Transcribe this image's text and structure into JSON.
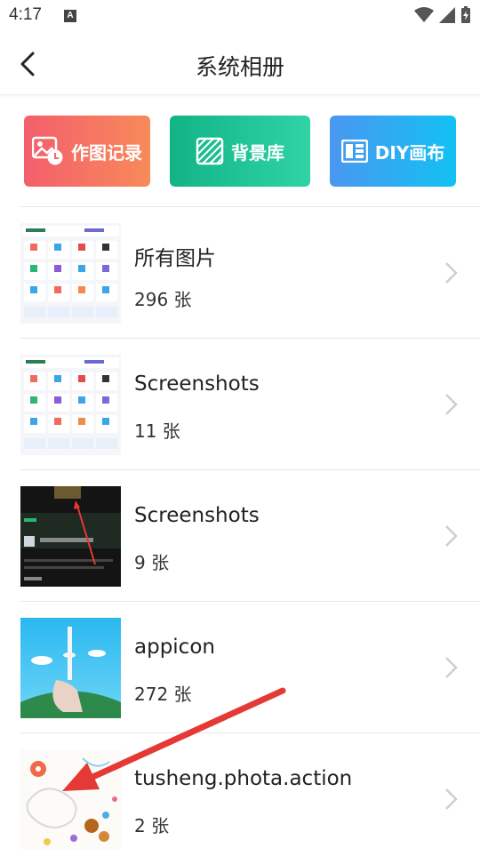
{
  "status_bar": {
    "time": "4:17"
  },
  "header": {
    "title": "系统相册"
  },
  "shortcuts": [
    {
      "label": "作图记录",
      "icon": "image-clock-icon"
    },
    {
      "label": "背景库",
      "icon": "pattern-icon"
    },
    {
      "label": "DIY画布",
      "icon": "layout-icon"
    }
  ],
  "albums": [
    {
      "name": "所有图片",
      "count": "296 张"
    },
    {
      "name": "Screenshots",
      "count": "11 张"
    },
    {
      "name": "Screenshots",
      "count": "9 张"
    },
    {
      "name": "appicon",
      "count": "272 张"
    },
    {
      "name": "tusheng.phota.action",
      "count": "2 张"
    }
  ],
  "colors": {
    "annotation_arrow": "#e53935"
  }
}
